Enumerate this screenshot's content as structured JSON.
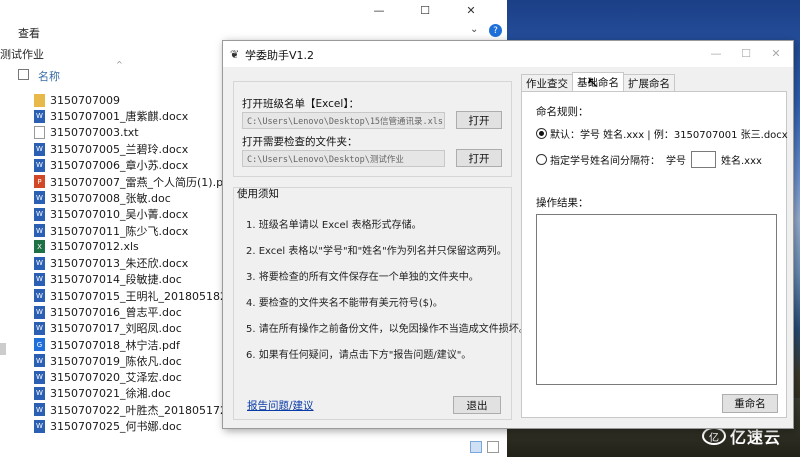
{
  "explorer": {
    "view_tab": "查看",
    "left_label": "测试作业",
    "column_name": "名称",
    "sort_glyph": "^",
    "files": [
      {
        "name": "3150707009",
        "type": "folder"
      },
      {
        "name": "3150707001_唐紫麒.docx",
        "type": "docx"
      },
      {
        "name": "3150707003.txt",
        "type": "txt"
      },
      {
        "name": "3150707005_兰碧玲.docx",
        "type": "docx"
      },
      {
        "name": "3150707006_章小苏.docx",
        "type": "docx"
      },
      {
        "name": "3150707007_雷燕_个人简历(1).pptx",
        "type": "pptx"
      },
      {
        "name": "3150707008_张敏.doc",
        "type": "doc"
      },
      {
        "name": "3150707010_吴小菁.docx",
        "type": "docx"
      },
      {
        "name": "3150707011_陈少飞.docx",
        "type": "docx"
      },
      {
        "name": "3150707012.xls",
        "type": "xls"
      },
      {
        "name": "3150707013_朱还欣.docx",
        "type": "docx"
      },
      {
        "name": "3150707014_段敏捷.doc",
        "type": "doc"
      },
      {
        "name": "3150707015_王明礼_20180518210...",
        "type": "doc"
      },
      {
        "name": "3150707016_曾志平.doc",
        "type": "doc"
      },
      {
        "name": "3150707017_刘昭凤.doc",
        "type": "doc"
      },
      {
        "name": "3150707018_林宁洁.pdf",
        "type": "pdf"
      },
      {
        "name": "3150707019_陈依凡.doc",
        "type": "doc"
      },
      {
        "name": "3150707020_艾泽宏.doc",
        "type": "doc"
      },
      {
        "name": "3150707021_徐湘.doc",
        "type": "doc"
      },
      {
        "name": "3150707022_叶胜杰_20180517215...",
        "type": "doc"
      },
      {
        "name": "3150707025_何书娜.doc",
        "type": "doc"
      }
    ]
  },
  "app": {
    "title": "学委助手V1.2",
    "class_list_label": "打开班级名单【Excel】：",
    "class_list_path": "C:\\Users\\Lenovo\\Desktop\\15信管通讯录.xls",
    "open_button_1": "打开",
    "folder_label": "打开需要检查的文件夹：",
    "folder_path": "C:\\Users\\Lenovo\\Desktop\\测试作业",
    "open_button_2": "打开",
    "help_title": "使用须知",
    "help_items": [
      "1. 班级名单请以 Excel 表格形式存储。",
      "2. Excel 表格以\"学号\"和\"姓名\"作为列名并只保留这两列。",
      "3. 将要检查的所有文件保存在一个单独的文件夹中。",
      "4. 要检查的文件夹名不能带有美元符号($)。",
      "5. 请在所有操作之前备份文件，以免因操作不当造成文件损坏。",
      "6. 如果有任何疑问，请点击下方\"报告问题/建议\"。"
    ],
    "report_link": "报告问题/建议",
    "exit_button": "退出",
    "tabs": [
      {
        "label": "作业查交",
        "active": false
      },
      {
        "label": "基础命名",
        "active": true
      },
      {
        "label": "扩展命名",
        "active": false
      }
    ],
    "naming_rule_label": "命名规则：",
    "radio_default": "默认：学号 姓名.xxx | 例：3150707001 张三.docx",
    "radio_default_selected": true,
    "radio_custom": "指定学号姓名间分隔符：",
    "custom_prefix": "学号",
    "custom_suffix": "姓名.xxx",
    "separator_value": "",
    "result_label": "操作结果：",
    "rename_button": "重命名"
  },
  "watermark": {
    "logo_text": "亿",
    "text": "亿速云"
  }
}
